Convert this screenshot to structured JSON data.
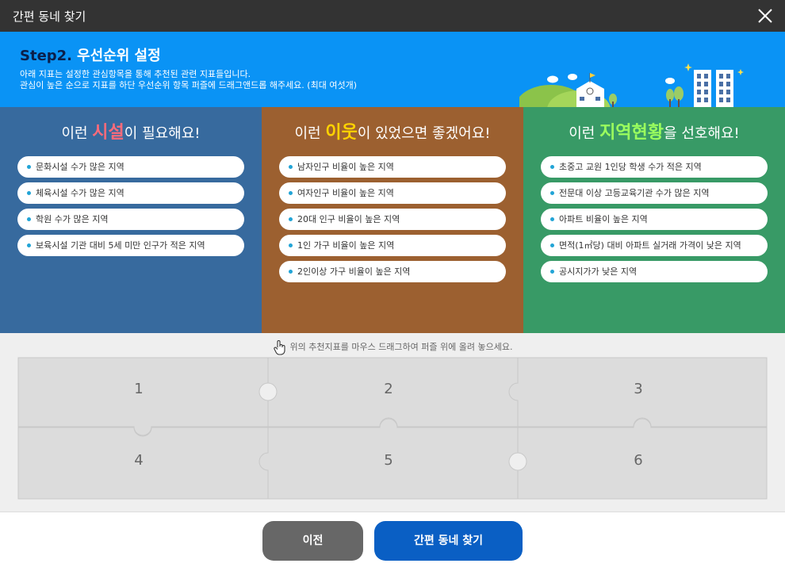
{
  "window": {
    "title": "간편 동네 찾기"
  },
  "banner": {
    "step_label": "Step2.",
    "step_title": "우선순위 설정",
    "desc_line1": "아래 지표는 설정한 관심항목을 통해 추천된 관련 지표들입니다.",
    "desc_line2": "관심이 높은 순으로 지표를 하단 우선순위 항목 퍼즐에 드래그앤드롭 해주세요. (최대 여섯개)"
  },
  "columns": [
    {
      "pre": "이런 ",
      "highlight": "시설",
      "post": "이 필요해요!",
      "items": [
        "문화시설 수가 많은 지역",
        "체육시설 수가 많은 지역",
        "학원 수가 많은 지역",
        "보육시설 기관 대비 5세 미만 인구가 적은 지역"
      ]
    },
    {
      "pre": "이런 ",
      "highlight": "이웃",
      "post": "이 있었으면 좋겠어요!",
      "items": [
        "남자인구 비율이 높은 지역",
        "여자인구 비율이 높은 지역",
        "20대 인구 비율이 높은 지역",
        "1인 가구 비율이 높은 지역",
        "2인이상 가구 비율이 높은 지역"
      ]
    },
    {
      "pre": "이런 ",
      "highlight": "지역현황",
      "post": "을 선호해요!",
      "items": [
        "초중고 교원 1인당 학생 수가 적은 지역",
        "전문대 이상 고등교육기관 수가 많은 지역",
        "아파트 비율이 높은 지역",
        "면적(1㎡당) 대비 아파트 실거래 가격이 낮은 지역",
        "공시지가가 낮은 지역"
      ]
    }
  ],
  "puzzle": {
    "hint": "위의 추천지표를 마우스 드래그하여 퍼즐 위에 올려 놓으세요.",
    "slots": [
      "1",
      "2",
      "3",
      "4",
      "5",
      "6"
    ]
  },
  "footer": {
    "prev_label": "이전",
    "next_label": "간편 동네 찾기"
  },
  "colors": {
    "titlebar": "#333333",
    "banner": "#0a93f5",
    "col_facility": "#376a9e",
    "col_neighbor": "#9c6030",
    "col_region": "#389a66",
    "accent_facility": "#ff6b7a",
    "accent_neighbor": "#ffd200",
    "accent_region": "#9bff5e",
    "prev_button": "#676767",
    "next_button": "#0a5fc4"
  },
  "icons": {
    "close": "close-icon",
    "hand": "hand-pointer-icon"
  }
}
